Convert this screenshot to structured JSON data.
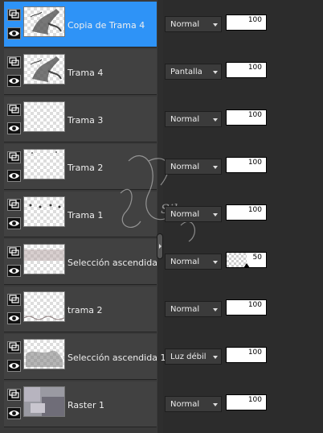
{
  "layers": [
    {
      "name": "Copia de Trama 4",
      "blend": "Normal",
      "opacity": 100,
      "selected": true,
      "thumb": "trama4"
    },
    {
      "name": "Trama 4",
      "blend": "Pantalla",
      "opacity": 100,
      "selected": false,
      "thumb": "trama4"
    },
    {
      "name": "Trama 3",
      "blend": "Normal",
      "opacity": 100,
      "selected": false,
      "thumb": "empty"
    },
    {
      "name": "Trama 2",
      "blend": "Normal",
      "opacity": 100,
      "selected": false,
      "thumb": "dots-few"
    },
    {
      "name": "Trama 1",
      "blend": "Normal",
      "opacity": 100,
      "selected": false,
      "thumb": "dots-row"
    },
    {
      "name": "Selección ascendida",
      "blend": "Normal",
      "opacity": 50,
      "selected": false,
      "thumb": "blur-band"
    },
    {
      "name": "trama 2",
      "blend": "Normal",
      "opacity": 100,
      "selected": false,
      "thumb": "bottom-lace"
    },
    {
      "name": "Selección ascendida 1",
      "blend": "Luz débil",
      "opacity": 100,
      "selected": false,
      "thumb": "smudge"
    },
    {
      "name": "Raster 1",
      "blend": "Normal",
      "opacity": 100,
      "selected": false,
      "thumb": "raster"
    }
  ],
  "watermark_text": "Silvana",
  "icons": {
    "visibility": "layer-group-icon",
    "eye": "eye-icon",
    "dropdown": "chevron-down-icon",
    "splitter": "panel-splitter-handle"
  },
  "colors": {
    "selected_row": "#2e93f7",
    "row": "#414141",
    "panel": "#2c2c2c"
  }
}
